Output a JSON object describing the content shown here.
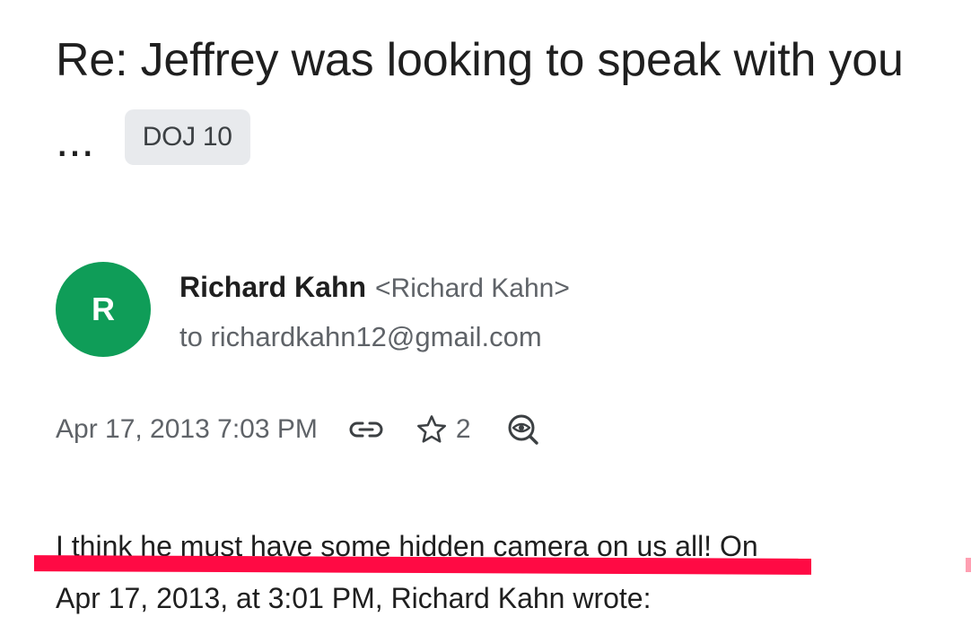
{
  "email": {
    "subject": "Re: Jeffrey was looking to speak with you ...",
    "label": "DOJ 10",
    "sender": {
      "avatar_initial": "R",
      "avatar_color": "#0f9d58",
      "name": "Richard Kahn",
      "email_display": "<Richard Kahn>",
      "recipient_line": "to richardkahn12@gmail.com"
    },
    "meta": {
      "date": "Apr 17, 2013 7:03 PM",
      "link_icon": "link-icon",
      "star_icon": "star-outline-icon",
      "star_count": "2",
      "view_icon": "eye-search-icon"
    },
    "body": {
      "line1": "I think he must have some hidden camera on us all! On",
      "line2": "Apr 17, 2013, at 3:01 PM, Richard Kahn wrote:"
    },
    "highlight_color": "#ff0a44"
  }
}
